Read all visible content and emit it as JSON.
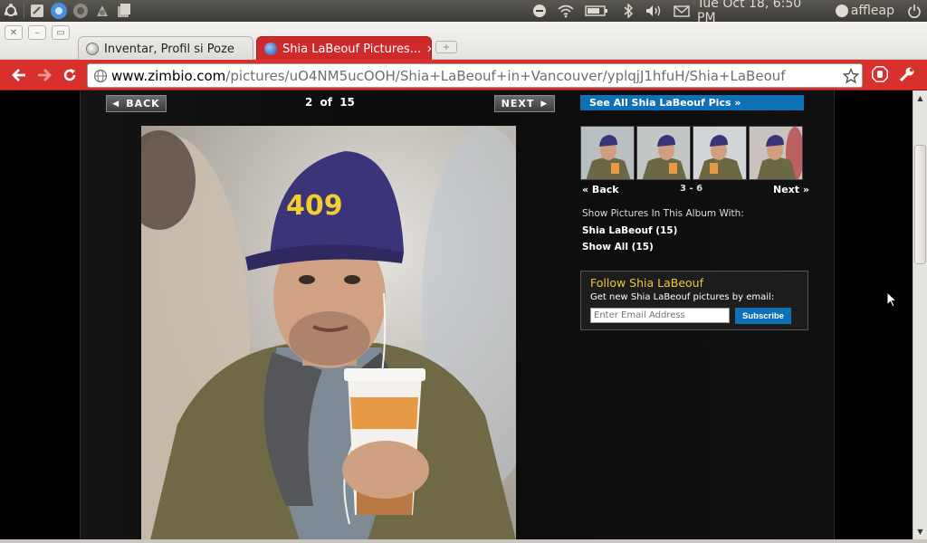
{
  "panel": {
    "datetime": "Tue Oct 18,  6:50 PM",
    "user": "affleap",
    "icons": [
      "ubuntu-logo-icon",
      "text-editor-icon",
      "chromium-icon",
      "system-monitor-icon",
      "network-tools-icon",
      "files-icon"
    ],
    "tray_icons": [
      "skype-icon",
      "wifi-icon",
      "battery-icon",
      "bluetooth-icon",
      "volume-icon",
      "mail-icon",
      "user-status-icon",
      "power-icon"
    ]
  },
  "window": {
    "buttons": [
      "close",
      "minimize",
      "maximize"
    ]
  },
  "tabs": [
    {
      "label": "Inventar, Profil si Poze",
      "active": false
    },
    {
      "label": "Shia LaBeouf Pictures...",
      "active": true
    }
  ],
  "omnibox": {
    "host": "www.zimbio.com",
    "path": "/pictures/uO4NM5ucOOH/Shia+LaBeouf+in+Vancouver/yplqjJ1hfuH/Shia+LaBeouf"
  },
  "gallery": {
    "back_label": "BACK",
    "next_label": "NEXT",
    "current": "2",
    "of_label": "of",
    "total": "15"
  },
  "sidebar": {
    "see_all": "See All Shia LaBeouf Pics »",
    "thumbs_back": "« Back",
    "thumbs_range": "3 - 6",
    "thumbs_next": "Next »",
    "show_label": "Show Pictures In This Album With:",
    "filter_1": "Shia LaBeouf (15)",
    "filter_2": "Show All (15)",
    "follow_title": "Follow Shia LaBeouf",
    "follow_sub": "Get new Shia LaBeouf pictures by email:",
    "email_placeholder": "Enter Email Address",
    "subscribe_label": "Subscribe"
  },
  "photo": {
    "cap_text": "409"
  },
  "colors": {
    "chrome_red": "#d8302c",
    "link_blue": "#0f70b8",
    "follow_yellow": "#f0c63a"
  }
}
